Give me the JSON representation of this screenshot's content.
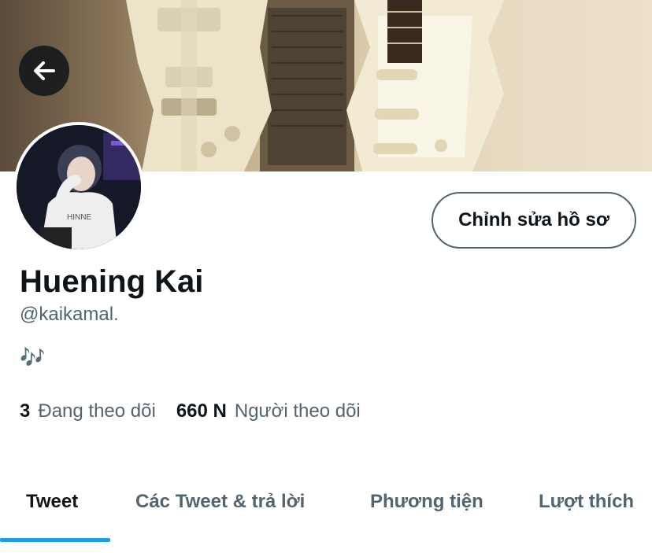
{
  "profile": {
    "display_name": "Huening Kai",
    "handle": "@kaikamal.",
    "bio": "🎶",
    "edit_button": "Chỉnh sửa hồ sơ"
  },
  "stats": {
    "following_count": "3",
    "following_label": "Đang theo dõi",
    "followers_count": "660 N",
    "followers_label": "Người theo dõi"
  },
  "tabs": [
    {
      "label": "Tweet",
      "active": true
    },
    {
      "label": "Các Tweet & trả lời",
      "active": false
    },
    {
      "label": "Phương tiện",
      "active": false
    },
    {
      "label": "Lượt thích",
      "active": false
    }
  ],
  "colors": {
    "accent": "#1d9bf0",
    "text_primary": "#0f1419",
    "text_secondary": "#536471"
  },
  "icons": {
    "back": "arrow-left-icon"
  }
}
